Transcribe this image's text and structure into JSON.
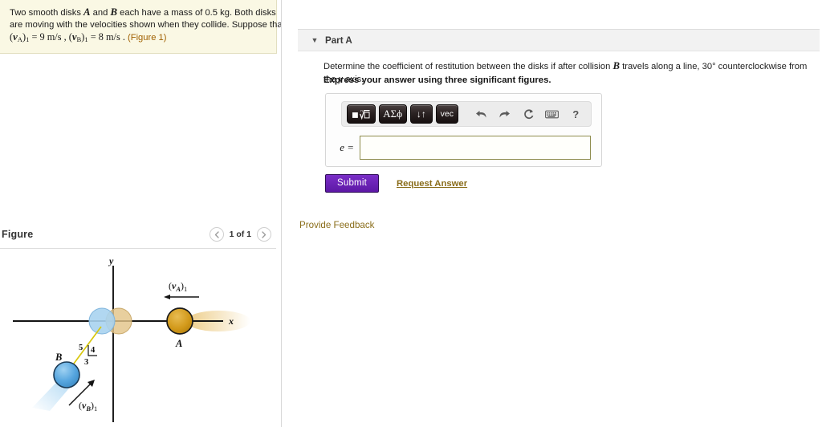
{
  "problem": {
    "line1_pre": "Two smooth disks ",
    "var_a": "A",
    "line1_mid": " and ",
    "var_b": "B",
    "line1_post": " each have a mass of 0.5 kg. Both disks",
    "line2": "are moving with the velocities shown when they collide. Suppose that",
    "va_symbol": "v",
    "va_sub": "A",
    "va_order": "1",
    "va_value": " = 9  m/s ,",
    "vb_symbol": "v",
    "vb_sub": "B",
    "vb_order": "1",
    "vb_value": " = 8  m/s .",
    "figure_link": "(Figure 1)"
  },
  "figure": {
    "title": "Figure",
    "pager_label": "1 of 1",
    "prev_icon": "chevron-left-icon",
    "next_icon": "chevron-right-icon",
    "labels": {
      "x_axis": "x",
      "y_axis": "y",
      "disk_a": "A",
      "disk_b": "B",
      "va_label_open": "(",
      "va_label_v": "v",
      "va_label_sub": "A",
      "va_label_close": ")",
      "va_label_order": "1",
      "vb_label_open": "(",
      "vb_label_v": "v",
      "vb_label_sub": "B",
      "vb_label_close": ")",
      "vb_label_order": "1",
      "triangle_hyp": "5",
      "triangle_vert": "4",
      "triangle_horiz": "3"
    },
    "colors": {
      "disk_a_fill": "#d9a020",
      "disk_b_fill": "#5ba8e0",
      "disk_ghost_blue": "#a8d2f0",
      "disk_ghost_gold": "#e6c78c",
      "triangle_line": "#d6c40a",
      "axis": "#1a1a1a"
    }
  },
  "part": {
    "toggle_icon": "chevron-down-icon",
    "label": "Part A",
    "question_pre": "Determine the coefficient of restitution between the disks if after collision ",
    "question_var": "B",
    "question_post_a": " travels along a line, 30° counterclockwise from the ",
    "question_var_y": "y",
    "question_post_b": " axis.",
    "sigfig_note": "Express your answer using three significant figures."
  },
  "answer": {
    "label": "e =",
    "value": "",
    "placeholder": "",
    "toolbar": [
      {
        "name": "template-math-button",
        "label": "■√□",
        "kind": "dark"
      },
      {
        "name": "greek-symbols-button",
        "label": "ΑΣϕ",
        "kind": "dark"
      },
      {
        "name": "updown-arrows-button",
        "label": "↓↑",
        "kind": "dark"
      },
      {
        "name": "vector-button",
        "label": "vec",
        "kind": "dark"
      },
      {
        "name": "undo-icon",
        "label": "undo",
        "kind": "icon"
      },
      {
        "name": "redo-icon",
        "label": "redo",
        "kind": "icon"
      },
      {
        "name": "reset-icon",
        "label": "reset",
        "kind": "icon"
      },
      {
        "name": "keyboard-icon",
        "label": "keyboard",
        "kind": "icon"
      },
      {
        "name": "help-icon",
        "label": "?",
        "kind": "icon"
      }
    ]
  },
  "actions": {
    "submit_label": "Submit",
    "request_answer_label": "Request Answer",
    "provide_feedback_label": "Provide Feedback",
    "submit_color": "#6a22b5",
    "link_color": "#8a6d1a"
  }
}
